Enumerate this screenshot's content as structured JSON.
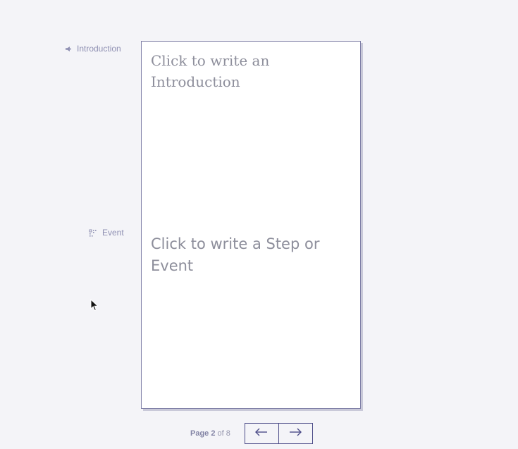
{
  "sections": {
    "introduction_label": "Introduction",
    "event_label": "Event",
    "introduction_icon": "megaphone-icon",
    "event_icon": "event-grid-icon"
  },
  "card": {
    "introduction_placeholder": "Click to write an Introduction",
    "event_placeholder": "Click to write a Step or Event"
  },
  "pager": {
    "page_word": "Page",
    "current_page": "2",
    "of_word": "of",
    "total_pages": "8",
    "prev_icon": "arrow-left-icon",
    "next_icon": "arrow-right-icon"
  },
  "colors": {
    "background": "#f4f4f8",
    "accent": "#4b4b88",
    "label": "#8e8fb2",
    "placeholder": "#8d8e9b"
  }
}
